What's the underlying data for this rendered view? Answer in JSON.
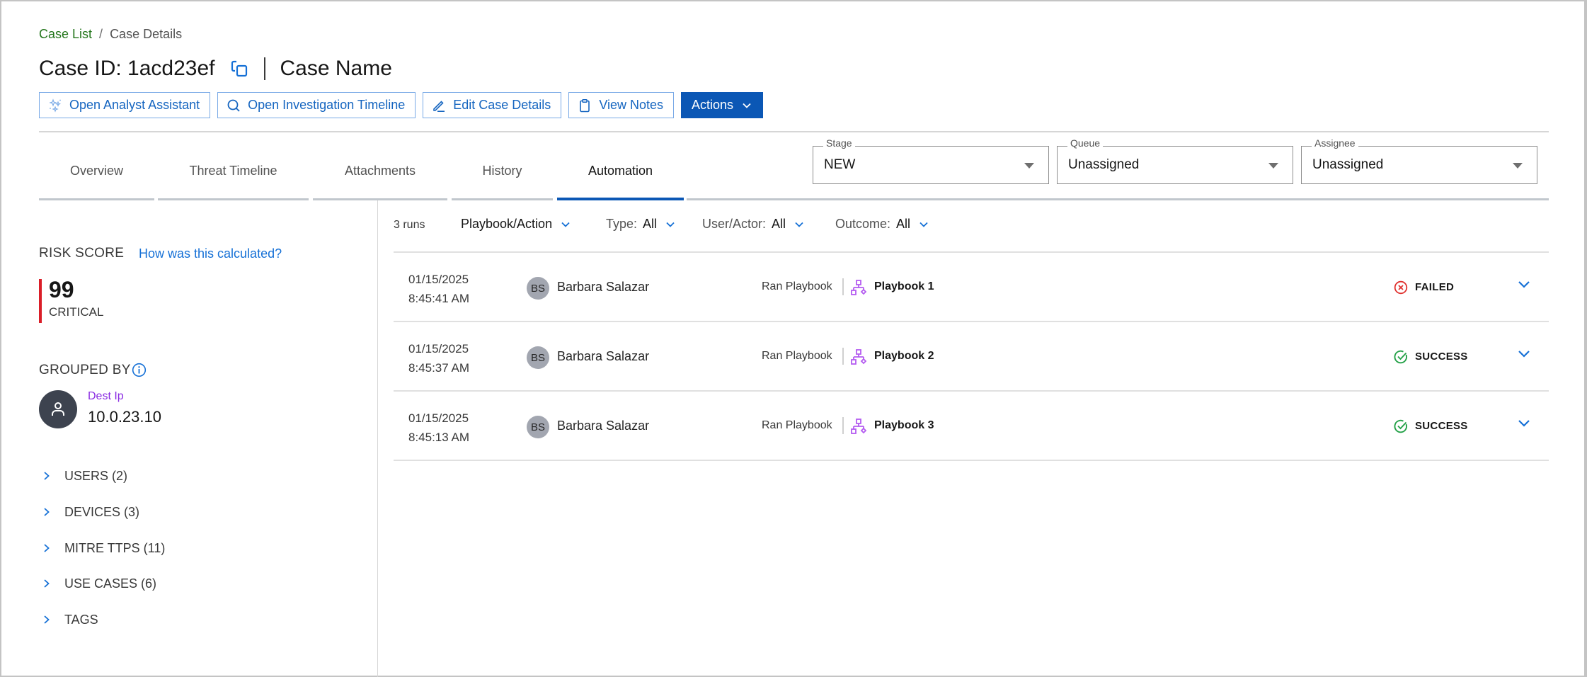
{
  "breadcrumb": {
    "parent": "Case List",
    "separator": "/",
    "current": "Case Details"
  },
  "header": {
    "case_id": "Case ID: 1acd23ef",
    "case_name": "Case Name"
  },
  "actions": {
    "analyst_assistant": "Open Analyst Assistant",
    "investigation_timeline": "Open Investigation Timeline",
    "edit_case": "Edit Case Details",
    "view_notes": "View Notes",
    "actions": "Actions"
  },
  "tabs": [
    {
      "label": "Overview"
    },
    {
      "label": "Threat Timeline"
    },
    {
      "label": "Attachments"
    },
    {
      "label": "History"
    },
    {
      "label": "Automation",
      "active": true
    }
  ],
  "selects": {
    "stage": {
      "label": "Stage",
      "value": "NEW"
    },
    "queue": {
      "label": "Queue",
      "value": "Unassigned"
    },
    "assignee": {
      "label": "Assignee",
      "value": "Unassigned"
    }
  },
  "left_panel": {
    "risk_label": "RISK SCORE",
    "risk_link": "How was this calculated?",
    "risk_score": "99",
    "risk_severity": "CRITICAL",
    "grouped_by_label": "GROUPED BY",
    "grouped_key": "Dest Ip",
    "grouped_value": "10.0.23.10",
    "sections": [
      {
        "label": "USERS (2)"
      },
      {
        "label": "DEVICES (3)"
      },
      {
        "label": "MITRE TTPS (11)"
      },
      {
        "label": "USE CASES (6)"
      },
      {
        "label": "TAGS"
      }
    ]
  },
  "filters": {
    "runs_count": "3 runs",
    "playbook_action": "Playbook/Action",
    "type_label": "Type:",
    "type_value": "All",
    "user_label": "User/Actor:",
    "user_value": "All",
    "outcome_label": "Outcome:",
    "outcome_value": "All"
  },
  "runs": [
    {
      "date": "01/15/2025",
      "time": "8:45:41 AM",
      "initials": "BS",
      "user": "Barbara Salazar",
      "action": "Ran Playbook",
      "playbook": "Playbook 1",
      "status": "FAILED"
    },
    {
      "date": "01/15/2025",
      "time": "8:45:37 AM",
      "initials": "BS",
      "user": "Barbara Salazar",
      "action": "Ran Playbook",
      "playbook": "Playbook 2",
      "status": "SUCCESS"
    },
    {
      "date": "01/15/2025",
      "time": "8:45:13 AM",
      "initials": "BS",
      "user": "Barbara Salazar",
      "action": "Ran Playbook",
      "playbook": "Playbook 3",
      "status": "SUCCESS"
    }
  ],
  "colors": {
    "primary": "#0b57b5",
    "link": "#1570d6",
    "critical": "#da1e28",
    "failed": "#e0322f",
    "success": "#24a148",
    "playbook_icon": "#b45cf0",
    "group_key": "#8a2be2"
  }
}
